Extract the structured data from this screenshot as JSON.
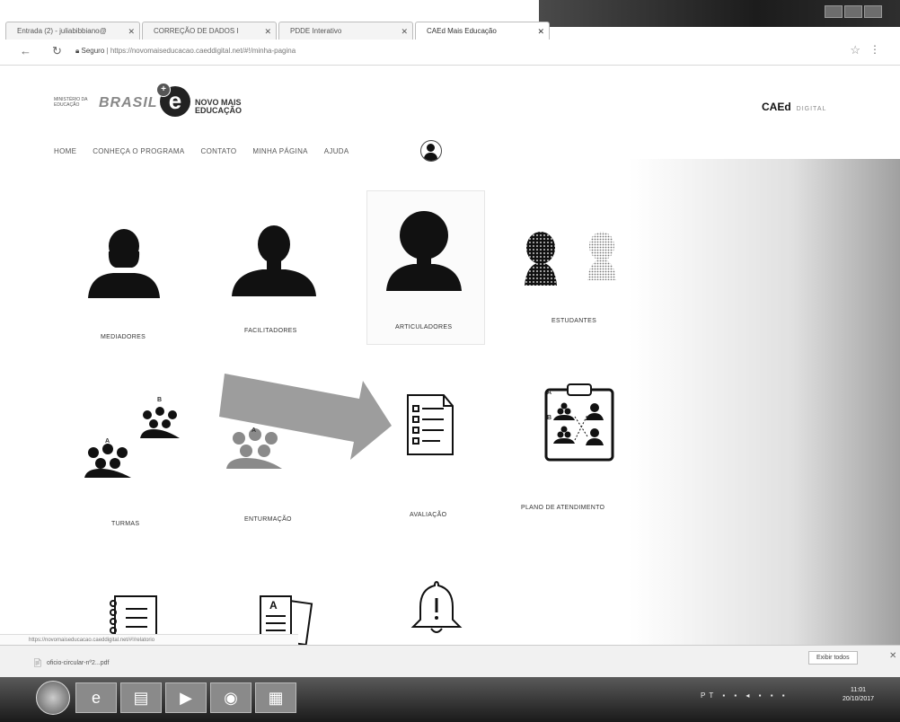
{
  "browser": {
    "tabs": [
      {
        "label": "Entrada (2) - juliabibbiano@",
        "active": false
      },
      {
        "label": "CORREÇÃO DE DADOS I",
        "active": false
      },
      {
        "label": "PDDE Interativo",
        "active": false
      },
      {
        "label": "CAEd Mais Educação",
        "active": true
      }
    ],
    "address": {
      "secure_label": "Seguro",
      "url": "https://novomaiseducacao.caeddigital.net/#!/minha-pagina"
    }
  },
  "header": {
    "gov_logo_text": "MINISTÉRIO DA EDUCAÇÃO",
    "brasil_logo_text": "BRASIL",
    "program_logo_line1": "NOVO MAIS",
    "program_logo_line2": "EDUCAÇÃO",
    "caed_brand": "CAEd",
    "caed_suffix": "DIGITAL"
  },
  "nav": {
    "items": [
      "HOME",
      "CONHEÇA O PROGRAMA",
      "CONTATO",
      "MINHA PÁGINA",
      "AJUDA"
    ]
  },
  "tiles": {
    "row1": [
      "MEDIADORES",
      "FACILITADORES",
      "ARTICULADORES",
      "ESTUDANTES"
    ],
    "row2": [
      "TURMAS",
      "ENTURMAÇÃO",
      "AVALIAÇÃO",
      "PLANO DE ATENDIMENTO"
    ],
    "turmas_group_a": "A",
    "turmas_group_b": "B",
    "plano_group_a": "A",
    "plano_group_b": "B",
    "enturmacao_group_a": "A"
  },
  "statusbar": {
    "text": "https://novomaiseducacao.caeddigital.net/#!/relatorio"
  },
  "downloads": {
    "file": "oficio-circular-nº2...pdf",
    "show_all": "Exibir todos"
  },
  "taskbar": {
    "lang": "PT",
    "time": "11:01",
    "date": "20/10/2017"
  },
  "colors": {
    "icon_dark": "#111111",
    "icon_gray": "#8a8a8a",
    "arrow": "#8c8c8c"
  }
}
